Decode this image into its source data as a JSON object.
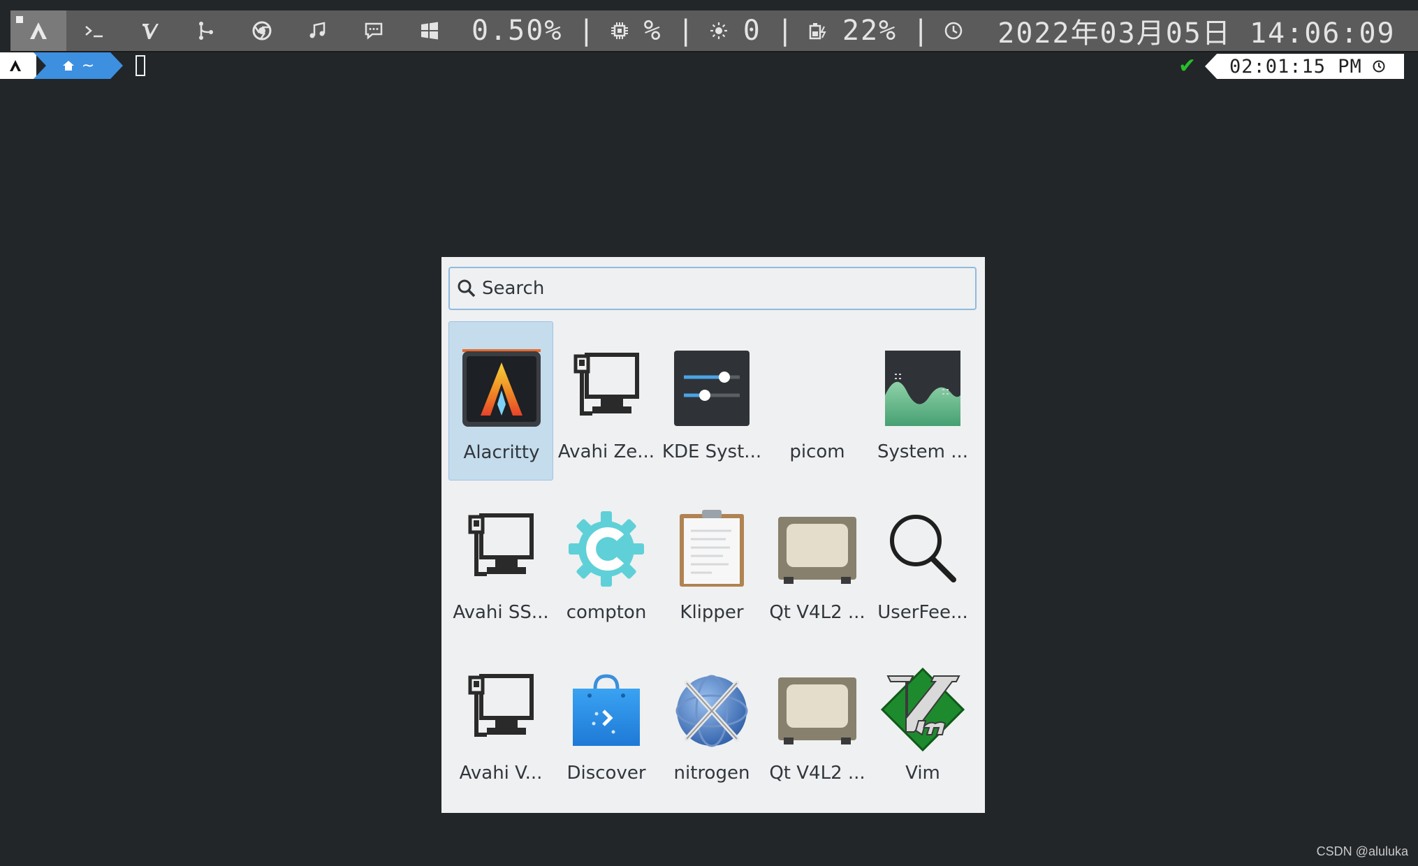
{
  "topbar": {
    "workspaces": [
      {
        "icon": "arch-icon",
        "active": true
      },
      {
        "icon": "terminal-icon",
        "active": false
      },
      {
        "icon": "vim-icon",
        "active": false
      },
      {
        "icon": "git-branch-icon",
        "active": false
      },
      {
        "icon": "chrome-icon",
        "active": false
      },
      {
        "icon": "music-icon",
        "active": false
      },
      {
        "icon": "chat-icon",
        "active": false
      },
      {
        "icon": "windows-icon",
        "active": false
      }
    ],
    "net_value": "0.50%",
    "sep": "|",
    "cpu_value": "%",
    "brightness_value": "0",
    "battery_value": "22%",
    "clock_value": "2022年03月05日 14:06:09"
  },
  "prompt": {
    "home_label": "~",
    "right_time": "02:01:15 PM",
    "status_symbol": "✔"
  },
  "launcher": {
    "search_placeholder": "Search",
    "apps": [
      {
        "label": "Alacritty",
        "icon": "alacritty-icon",
        "selected": true
      },
      {
        "label": "Avahi Ze...",
        "icon": "avahi-network-icon"
      },
      {
        "label": "KDE Syst...",
        "icon": "kde-settings-icon"
      },
      {
        "label": "picom",
        "icon": "picom-icon"
      },
      {
        "label": "System ...",
        "icon": "system-monitor-icon"
      },
      {
        "label": "Avahi SS...",
        "icon": "avahi-network-icon"
      },
      {
        "label": "compton",
        "icon": "compton-gear-icon"
      },
      {
        "label": "Klipper",
        "icon": "clipboard-icon"
      },
      {
        "label": "Qt V4L2 ...",
        "icon": "webcam-icon"
      },
      {
        "label": "UserFee...",
        "icon": "magnifier-icon"
      },
      {
        "label": "Avahi V...",
        "icon": "avahi-network-icon"
      },
      {
        "label": "Discover",
        "icon": "discover-bag-icon"
      },
      {
        "label": "nitrogen",
        "icon": "nitrogen-icon"
      },
      {
        "label": "Qt V4L2 ...",
        "icon": "webcam-icon"
      },
      {
        "label": "Vim",
        "icon": "vim-logo-icon"
      }
    ]
  },
  "watermark": "CSDN @aluluka",
  "colors": {
    "desktop": "#222629",
    "topbar": "#5b5b5b",
    "launcher_bg": "#eff0f1",
    "selection": "#c4dcec",
    "prompt_accent": "#3d8fe0",
    "status_ok": "#27c02a"
  }
}
